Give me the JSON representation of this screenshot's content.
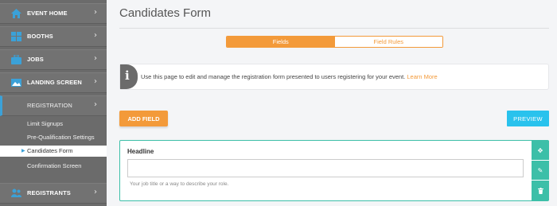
{
  "sidebar": {
    "items": [
      {
        "label": "EVENT HOME",
        "icon": "home-icon"
      },
      {
        "label": "BOOTHS",
        "icon": "grid-icon"
      },
      {
        "label": "JOBS",
        "icon": "briefcase-icon"
      },
      {
        "label": "LANDING SCREEN",
        "icon": "image-icon"
      },
      {
        "label": "REGISTRATION",
        "icon": "form-icon"
      },
      {
        "label": "REGISTRANTS",
        "icon": "users-icon"
      }
    ],
    "sub_items": [
      {
        "label": "Limit Signups"
      },
      {
        "label": "Pre-Qualification Settings"
      },
      {
        "label": "Candidates Form"
      },
      {
        "label": "Confirmation Screen"
      }
    ]
  },
  "main": {
    "title": "Candidates Form",
    "tabs": [
      {
        "label": "Fields"
      },
      {
        "label": "Field Rules"
      }
    ],
    "info": {
      "text": "Use this page to edit and manage the registration form presented to users registering for your event. ",
      "link": "Learn More"
    },
    "add_field_label": "ADD FIELD",
    "preview_label": "PREVIEW",
    "field": {
      "label": "Headline",
      "value": "",
      "help": "Your job title or a way to describe your role."
    }
  },
  "colors": {
    "accent_orange": "#f39a3a",
    "preview_blue": "#29c2ed",
    "field_teal": "#3cbfa8",
    "sidebar_gray": "#6b6b6b"
  }
}
